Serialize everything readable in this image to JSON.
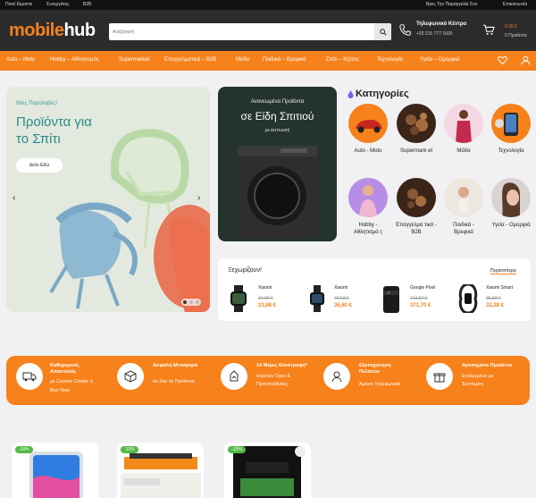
{
  "topbar": {
    "left": [
      "Ποιοί Είμαστε",
      "Συνεργάτες",
      "B2B"
    ],
    "right": [
      "Βρες Την Παραγγελία Σου",
      "Επικοινωνία"
    ]
  },
  "header": {
    "logo_part1": "mobile",
    "logo_part2": "hub",
    "search_placeholder": "Αναζήτηση",
    "phone_title": "Τηλεφωνικό Κέντρο",
    "phone_number": "+30 215 777 1600",
    "cart_total": "0.00 €",
    "cart_count": "0 Προϊόντα"
  },
  "nav": {
    "items": [
      "Auto – Moto",
      "Hobby – Αθλητισμός",
      "Supermarket",
      "Επαγγελματικά – B2B",
      "Μόδα",
      "Παιδικά – Βρεφικά",
      "Σπίτι – Κήπος",
      "Τεχνολογία",
      "Υγεία – Ομορφιά"
    ]
  },
  "hero": {
    "subtitle": "Νέες Παραλαβές!",
    "title": "Προϊόντα για το Σπίτι",
    "button": "Δείτε Εδώ",
    "prev": "‹",
    "next": "›"
  },
  "promo": {
    "subtitle": "Ανανεωμένα Προϊόντα",
    "title": "σε Είδη Σπιτιού",
    "note": "με έκπτωση!"
  },
  "categories": {
    "title": "Κατηγορίες",
    "items": [
      "Auto - Moto",
      "Supermark et",
      "Μόδα",
      "Τεχνολογία",
      "Hobby - Αθλητισμό ς",
      "Επαγγελμα τικά - B2B",
      "Παιδικά - Βρεφικά",
      "Υγεία - Ομορφιά"
    ]
  },
  "featured": {
    "title": "Ξεχωρίζουν!",
    "more": "Περισσότερα",
    "products": [
      {
        "name": "Xiaomi",
        "old": "34,90 €",
        "price": "23,88 €"
      },
      {
        "name": "Xiaomi",
        "old": "40,63 €",
        "price": "36,60 €"
      },
      {
        "name": "Google Pixel",
        "old": "412,57 €",
        "price": "371,70 €"
      },
      {
        "name": "Xiaomi Smart",
        "old": "35,83 €",
        "price": "32,28 €"
      }
    ]
  },
  "benefits": [
    {
      "title": "Καθημερινές Αποστολές",
      "sub1": "με Courier Center ή",
      "sub2": "Box Now"
    },
    {
      "title": "Ασφαλή Μεταφορά",
      "sub1": "σε όλα τα Προϊόντα",
      "sub2": ""
    },
    {
      "title": "14 Μέρες Επιστροφή*",
      "sub1": "Ισχύουν Όροι &",
      "sub2": "Προϋποθέσεις"
    },
    {
      "title": "Εξυπηρέτηση Πελατών",
      "sub1": "Άμεσα Τηλεφωνικά",
      "sub2": ""
    },
    {
      "title": "Αγαπημένα Προϊόντα",
      "sub1": "Επιλεγμένα με",
      "sub2": "Έκπτωση"
    }
  ],
  "cards": [
    {
      "badge": "-10%"
    },
    {
      "badge": "-10%"
    },
    {
      "badge": "-10%"
    }
  ],
  "colors": {
    "accent": "#f7811a",
    "header": "#2b2b2d",
    "badge": "#53b947"
  }
}
